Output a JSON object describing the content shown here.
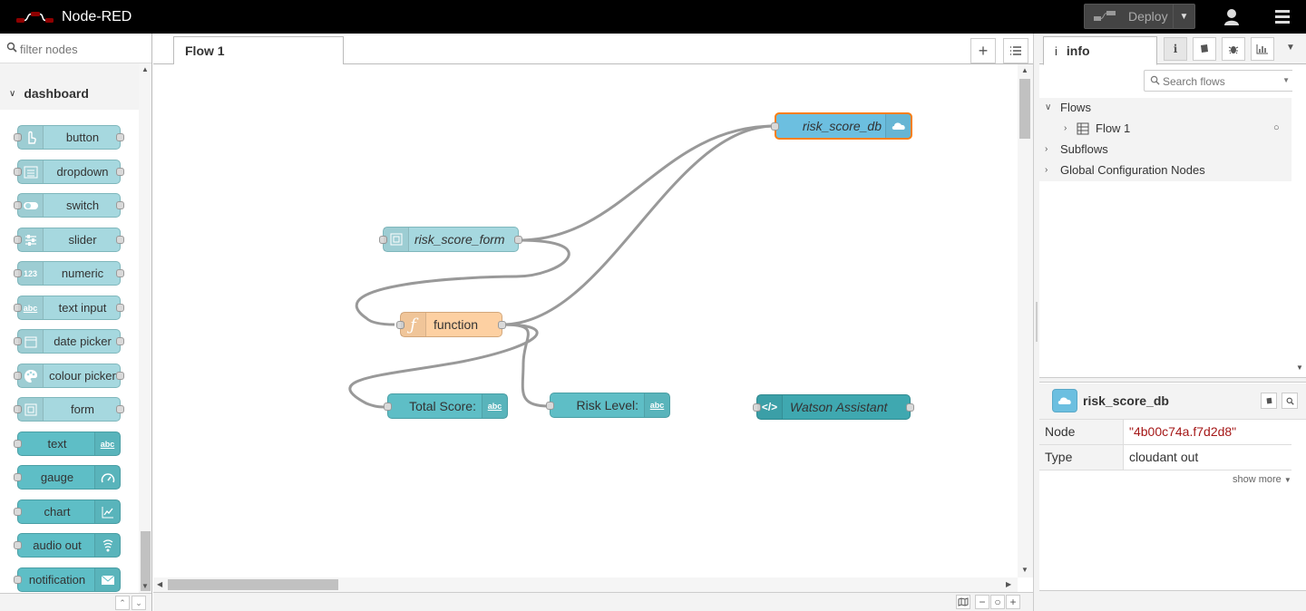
{
  "header": {
    "app_title": "Node-RED",
    "deploy_label": "Deploy"
  },
  "palette": {
    "search_placeholder": "filter nodes",
    "category": "dashboard",
    "nodes": [
      {
        "label": "button",
        "icon": "hand-pointer-icon"
      },
      {
        "label": "dropdown",
        "icon": "list-icon"
      },
      {
        "label": "switch",
        "icon": "toggle-icon"
      },
      {
        "label": "slider",
        "icon": "sliders-icon"
      },
      {
        "label": "numeric",
        "icon": "123-icon"
      },
      {
        "label": "text input",
        "icon": "abc-icon"
      },
      {
        "label": "date picker",
        "icon": "calendar-icon"
      },
      {
        "label": "colour picker",
        "icon": "palette-icon"
      },
      {
        "label": "form",
        "icon": "form-icon"
      },
      {
        "label": "text",
        "icon": "abc-icon"
      },
      {
        "label": "gauge",
        "icon": "gauge-icon"
      },
      {
        "label": "chart",
        "icon": "chart-icon"
      },
      {
        "label": "audio out",
        "icon": "audio-icon"
      },
      {
        "label": "notification",
        "icon": "envelope-icon"
      }
    ]
  },
  "workspace": {
    "tabs": [
      {
        "label": "Flow 1"
      }
    ],
    "nodes": {
      "db": "risk_score_db",
      "form": "risk_score_form",
      "function": "function",
      "total": "Total Score:",
      "risk": "Risk Level:",
      "watson": "Watson Assistant"
    }
  },
  "sidebar": {
    "tab_label": "info",
    "search_placeholder": "Search flows",
    "tree": {
      "flows": "Flows",
      "flow1": "Flow 1",
      "subflows": "Subflows",
      "global_config": "Global Configuration Nodes"
    },
    "selected": {
      "title": "risk_score_db",
      "rows": [
        {
          "key": "Node",
          "value": "\"4b00c74a.f7d2d8\""
        },
        {
          "key": "Type",
          "value": "cloudant out"
        }
      ],
      "show_more": "show more"
    }
  },
  "colors": {
    "ui_node": "#a6d8df",
    "ui_dark": "#5ebec6",
    "function_node": "#fdd0a2",
    "db_node": "#6cbfe0",
    "selected_outline": "#ff7f0e",
    "watson_node": "#3fa8b0"
  }
}
